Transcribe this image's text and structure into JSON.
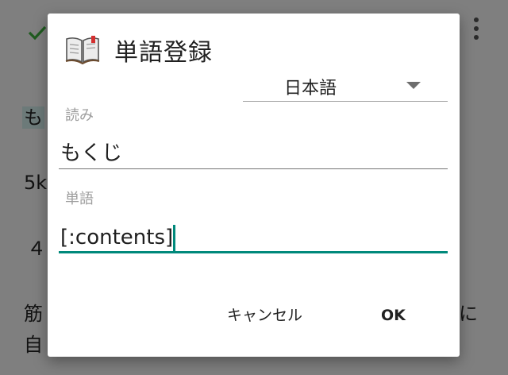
{
  "background": {
    "line1": "も",
    "line2": "5k",
    "line3": "４",
    "line4": "筋",
    "line5": "自",
    "right_char": "に"
  },
  "dialog": {
    "title": "単語登録",
    "language": {
      "selected": "日本語"
    },
    "reading": {
      "label": "読み",
      "value": "もくじ"
    },
    "word": {
      "label": "単語",
      "value": "[:contents]"
    },
    "actions": {
      "cancel": "キャンセル",
      "ok": "OK"
    }
  },
  "colors": {
    "accent": "#00897b",
    "scrim": "#7f7f7f",
    "dialog_bg": "#ffffff"
  },
  "icons": {
    "title_icon": "book-icon",
    "confirm_icon": "check-icon",
    "menu_icon": "more-vert-icon",
    "dropdown_icon": "triangle-down-icon"
  }
}
